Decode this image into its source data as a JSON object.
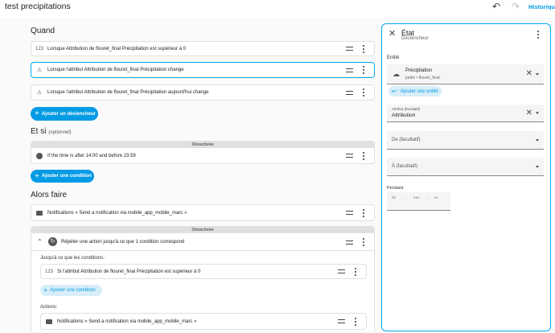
{
  "header": {
    "title": "test precipitations",
    "undo_icon": "undo-icon",
    "redo_icon": "redo-icon",
    "history_label": "Historique d"
  },
  "when": {
    "title": "Quand",
    "triggers": [
      {
        "icon": "123",
        "text": "Lorsque Attribution de flouret_final Précipitation est supérieur à 0"
      },
      {
        "icon": "⚠",
        "text": "Lorsque l'attribut Attribution de flouret_final Précipitation change"
      },
      {
        "icon": "⚠",
        "text": "Lorsque l'attribut Attribution de flouret_final Précipitation aujourd'hui change"
      }
    ],
    "add_label": "Ajouter un déclencheur"
  },
  "conditions": {
    "title": "Et si",
    "optional": "(optionnel)",
    "disabled_label": "Désactivée",
    "item_text": "If the time is after 14:00 and before 23:59",
    "add_label": "Ajouter une condition"
  },
  "actions": {
    "title": "Alors faire",
    "notify1": "Notifications « Send a notification via mobile_app_mobile_marc »",
    "disabled_label": "Désactivée",
    "repeat_text": "Répéter une action jusqu'à ce que 1 condition correspond",
    "until_label": "Jusqu'à ce que les conditions:",
    "until_item": "Si l'attribut Attribution de flouret_final Précipitation est supérieur à 0",
    "add_condition": "Ajouter une condition",
    "actions_label": "Actions:",
    "notify2": "Notifications « Send a notification via mobile_app_mobile_marc »"
  },
  "panel": {
    "title": "État",
    "subtitle": "Déclencheur",
    "entity_label": "Entité",
    "entity_name": "Précipitation",
    "entity_sub": "jardin • flouret_final",
    "add_entity": "Ajouter une entité",
    "attribute_label": "Attribut (facultatif)",
    "attribute_value": "Attribution",
    "from_placeholder": "De (facultatif)",
    "to_placeholder": "À (facultatif)",
    "duration_label": "Pendant",
    "hh": "hh",
    "mm": "mm",
    "ss": "ss",
    "sep": ":"
  },
  "colors": {
    "accent": "#039be5",
    "border_selected": "#03a9f4"
  }
}
